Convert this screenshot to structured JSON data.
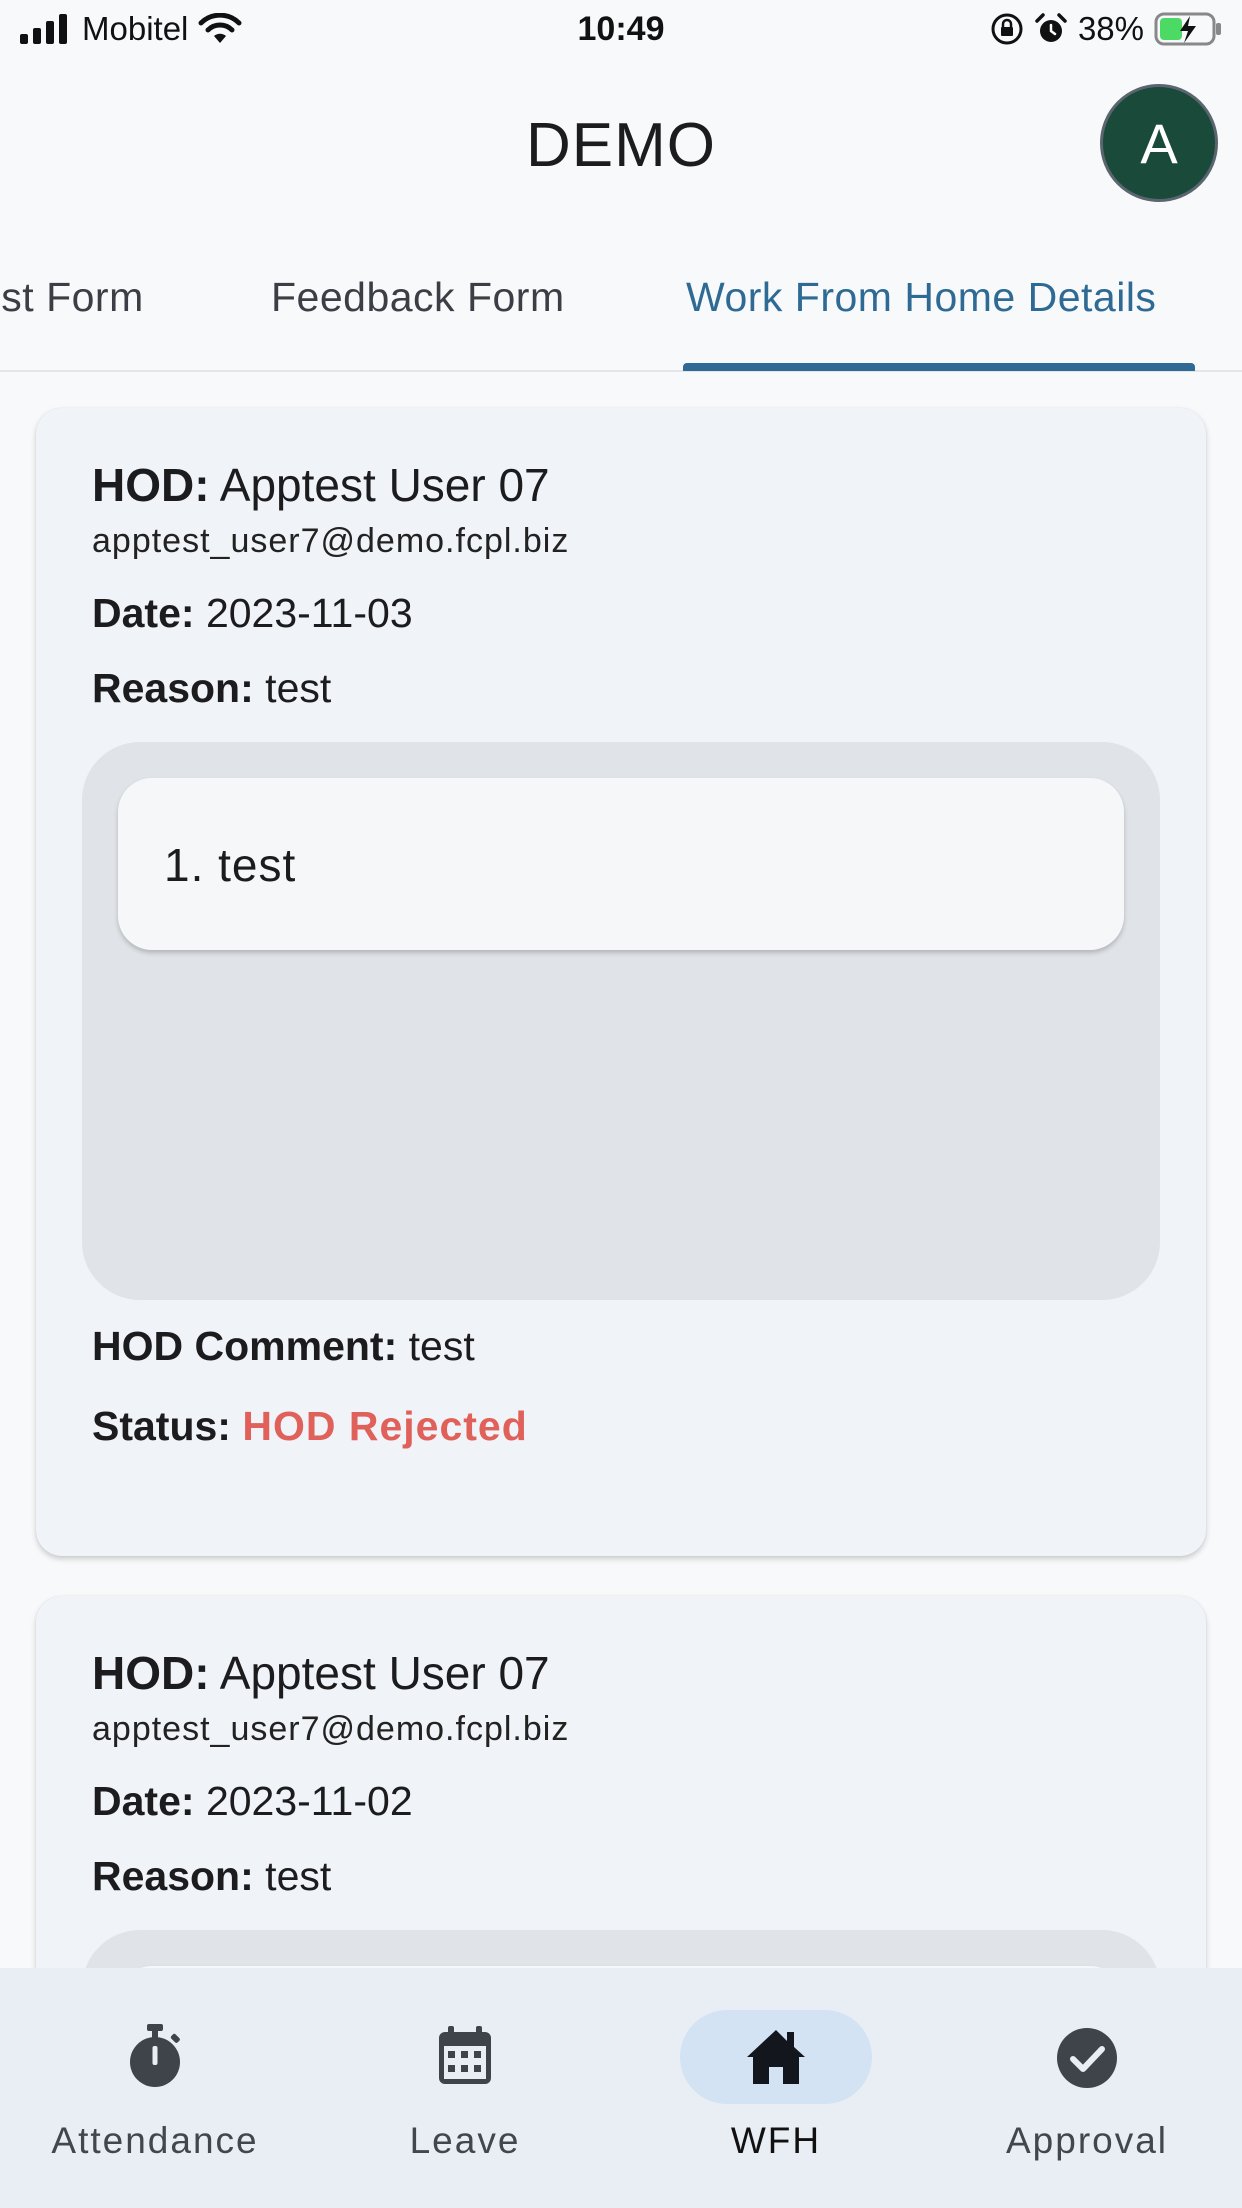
{
  "status_bar": {
    "carrier": "Mobitel",
    "time": "10:49",
    "battery": "38%"
  },
  "app_bar": {
    "title": "DEMO",
    "avatar_initial": "A"
  },
  "tabs": [
    {
      "label": "est Form"
    },
    {
      "label": "Feedback Form"
    },
    {
      "label": "Work From Home Details",
      "active": true
    }
  ],
  "labels": {
    "hod": "HOD:",
    "date": "Date:",
    "reason": "Reason:",
    "hod_comment": "HOD Comment:",
    "status": "Status:"
  },
  "records": [
    {
      "hod_name": "Apptest User 07",
      "hod_email": "apptest_user7@demo.fcpl.biz",
      "date": "2023-11-03",
      "reason": "test",
      "items": [
        "1. test"
      ],
      "hod_comment": "test",
      "status": "HOD Rejected"
    },
    {
      "hod_name": "Apptest User 07",
      "hod_email": "apptest_user7@demo.fcpl.biz",
      "date": "2023-11-02",
      "reason": "test"
    }
  ],
  "bottom_nav": [
    {
      "label": "Attendance",
      "icon": "stopwatch-icon"
    },
    {
      "label": "Leave",
      "icon": "calendar-icon"
    },
    {
      "label": "WFH",
      "icon": "home-icon",
      "active": true
    },
    {
      "label": "Approval",
      "icon": "check-circle-icon"
    }
  ],
  "colors": {
    "accent": "#2e6a94",
    "rejected": "#e0605a",
    "avatar_bg": "#1a4a3a",
    "nav_active_pill": "#d3e3f3"
  }
}
